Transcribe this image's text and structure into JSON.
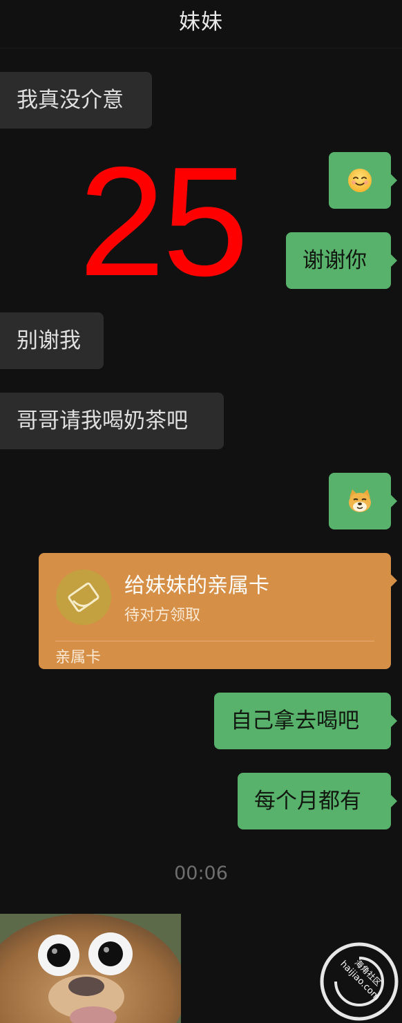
{
  "header": {
    "title": "妹妹"
  },
  "messages": {
    "m1": {
      "text": "我真没介意"
    },
    "m2": {
      "emoji": "smiling-face"
    },
    "m3": {
      "text": "谢谢你"
    },
    "m4": {
      "text": "别谢我"
    },
    "m5": {
      "text": "哥哥请我喝奶茶吧"
    },
    "m6": {
      "emoji": "doge"
    },
    "card": {
      "title": "给妹妹的亲属卡",
      "subtitle": "待对方领取",
      "footer": "亲属卡",
      "icon": "family-card-icon"
    },
    "m7": {
      "text": "自己拿去喝吧"
    },
    "m8": {
      "text": "每个月都有"
    }
  },
  "timestamp": "00:06",
  "overlay_number": "25",
  "watermark": {
    "brand": "海角社区",
    "domain": "haijiao.com"
  },
  "colors": {
    "outgoing_bubble": "#59b26b",
    "incoming_bubble": "#2c2c2c",
    "card": "#d68f47",
    "overlay": "#ff0000"
  }
}
